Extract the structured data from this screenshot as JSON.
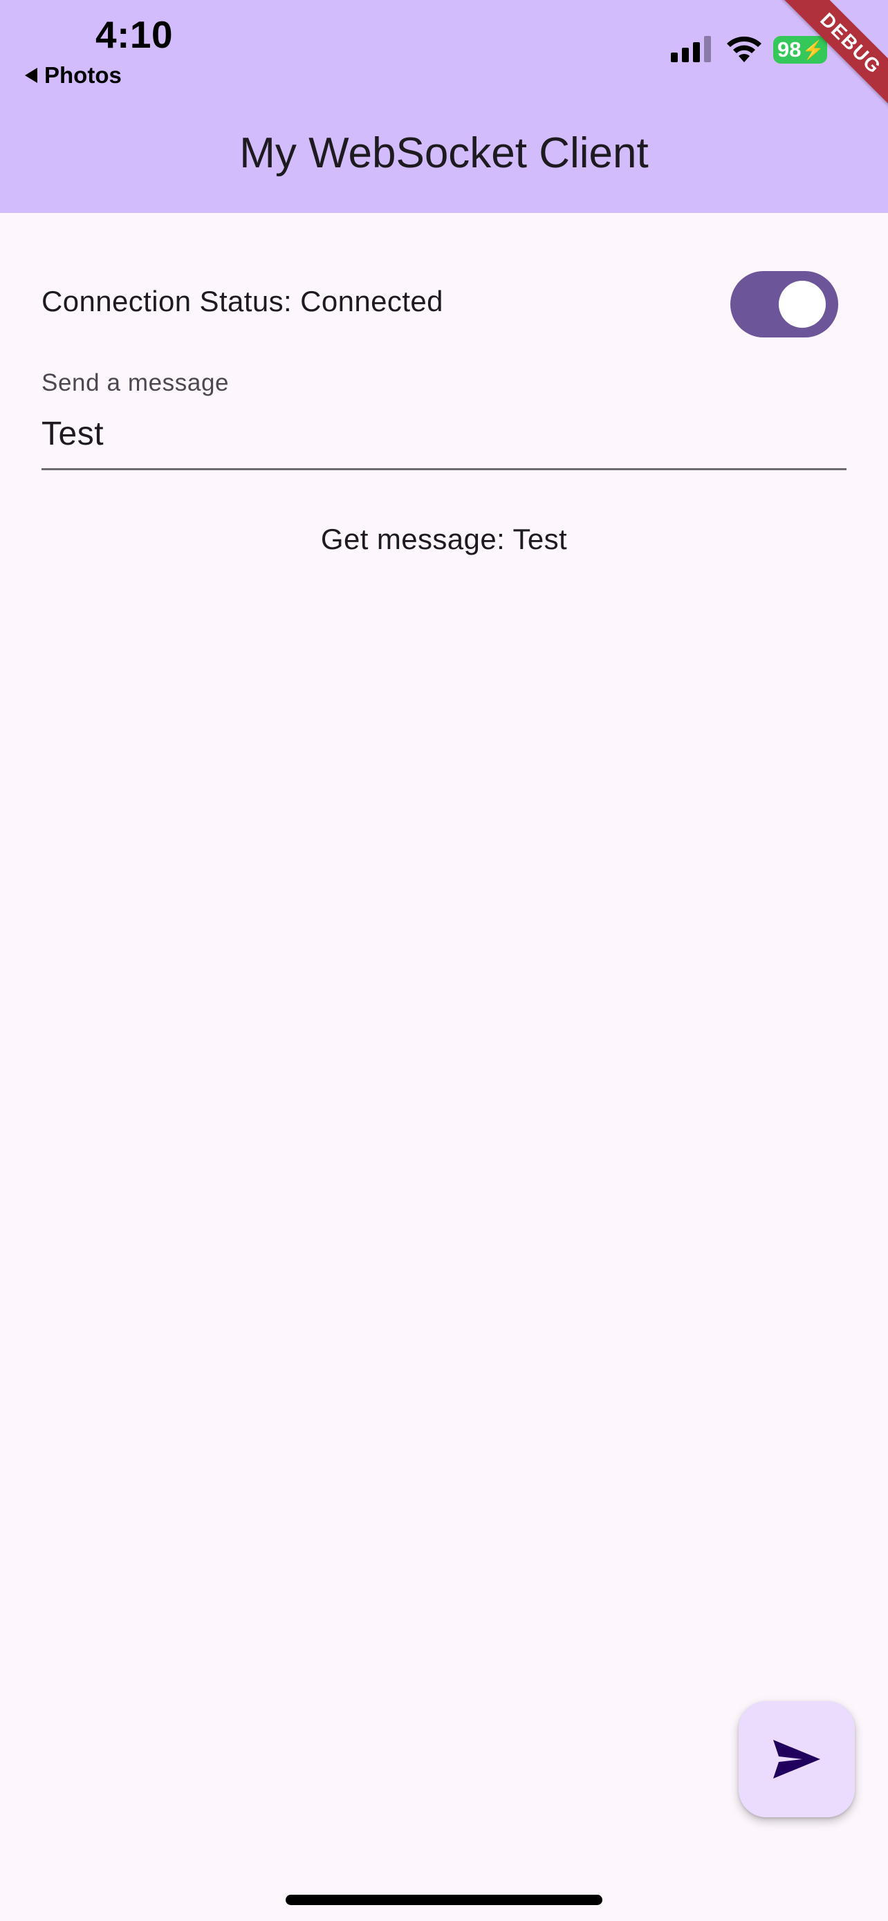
{
  "status_bar": {
    "time": "4:10",
    "back_label": "Photos",
    "battery": "98"
  },
  "debug_banner": "DEBUG",
  "appbar": {
    "title": "My WebSocket Client"
  },
  "connection": {
    "status_text": "Connection Status: Connected",
    "toggle_on": true
  },
  "message_field": {
    "label": "Send a message",
    "value": "Test"
  },
  "received": {
    "text": "Get message: Test"
  },
  "fab": {
    "icon": "send-icon"
  },
  "colors": {
    "appbar": "#d3bcfb",
    "background": "#fdf7fd",
    "switch_track": "#6c5598",
    "fab": "#ebdcfd",
    "battery": "#34c759",
    "debug_banner": "#b0303c"
  }
}
